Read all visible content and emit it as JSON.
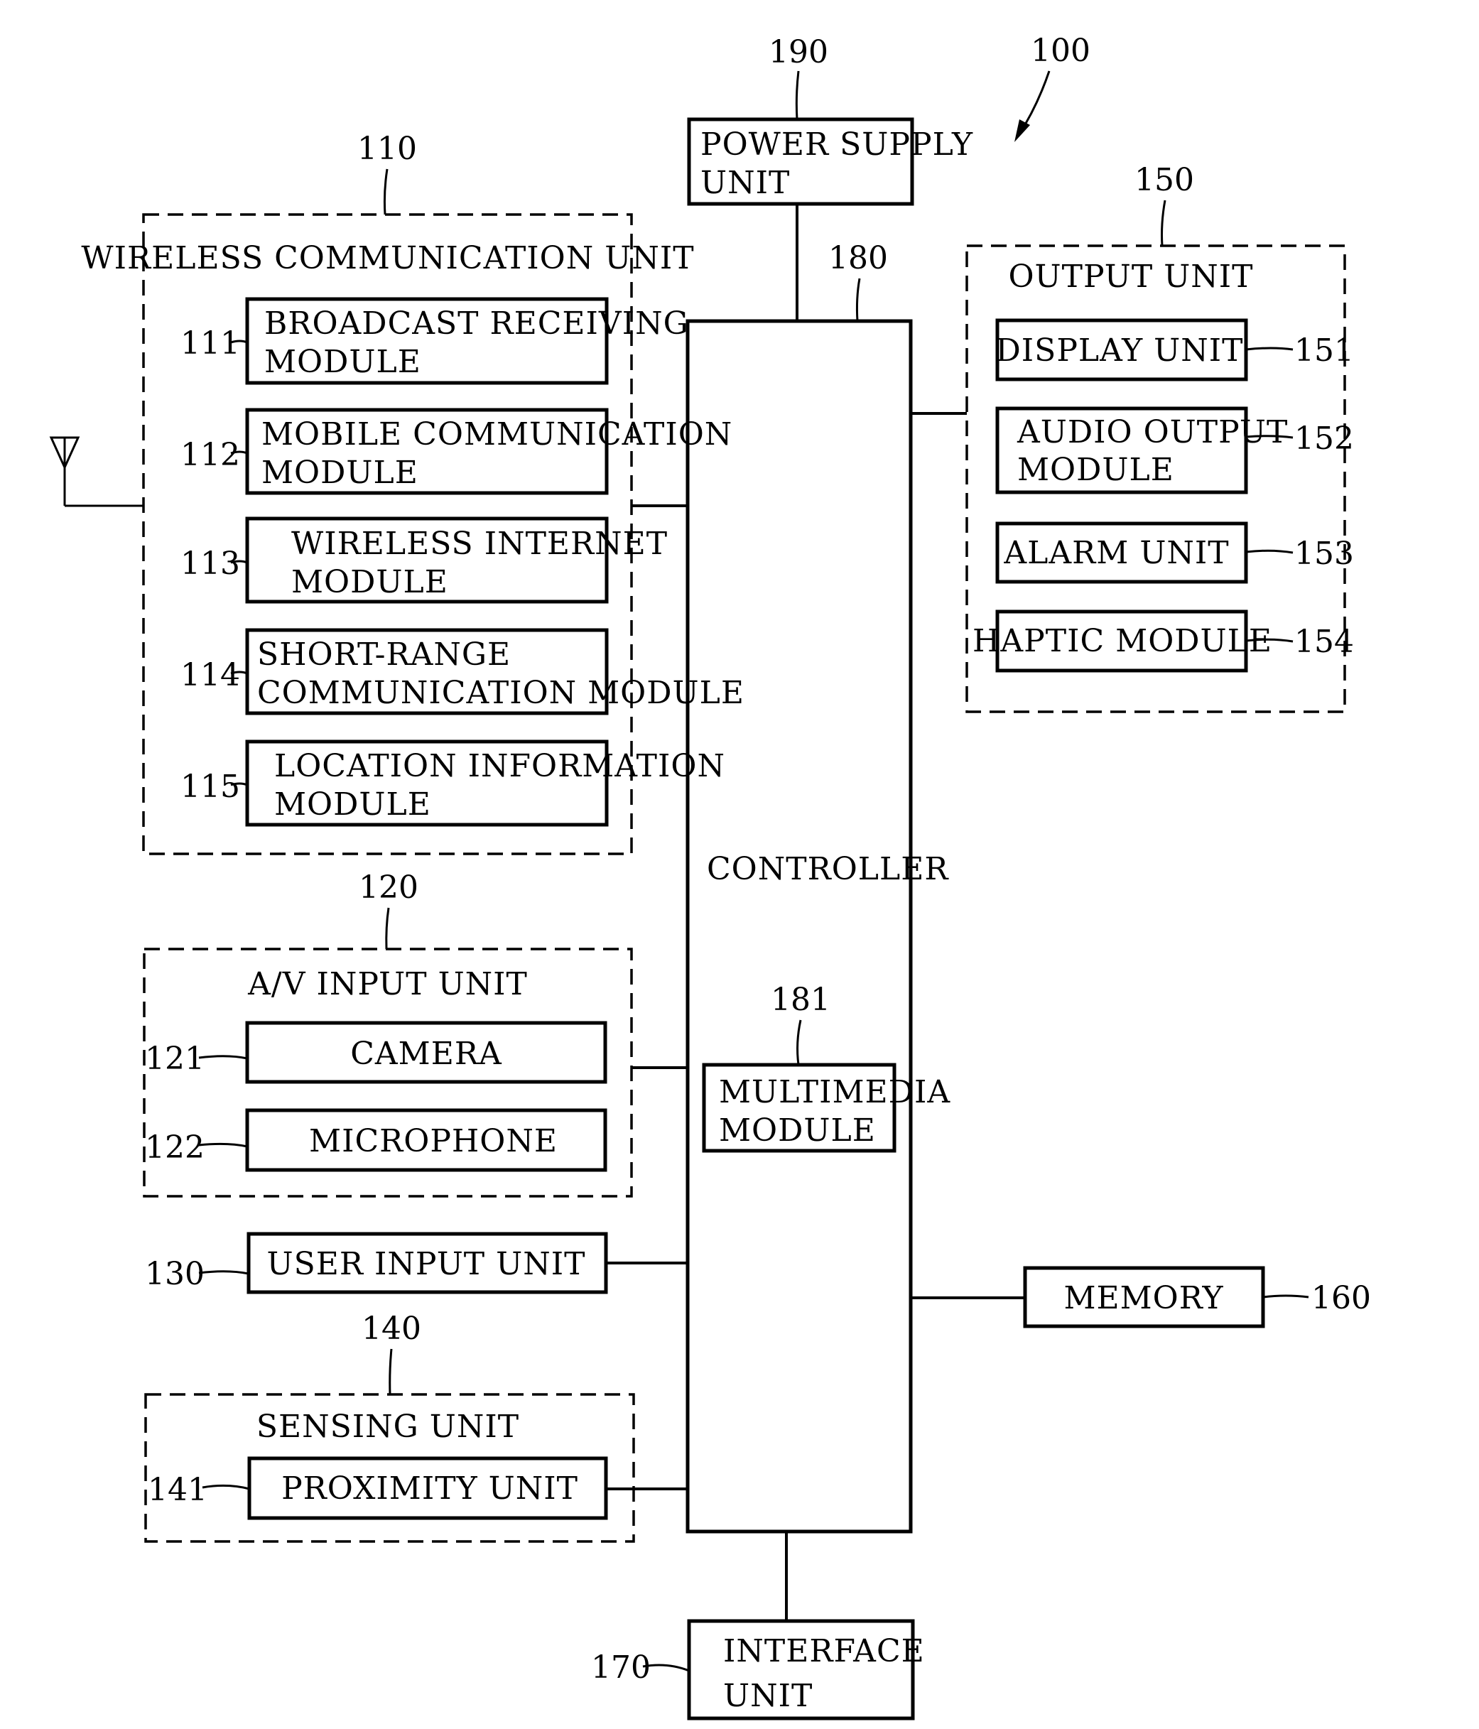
{
  "figure": {
    "ref": "100",
    "power_supply": {
      "ref": "190",
      "line1": "POWER SUPPLY",
      "line2": "UNIT"
    },
    "controller": {
      "ref": "180",
      "label": "CONTROLLER",
      "multimedia": {
        "ref": "181",
        "line1": "MULTIMEDIA",
        "line2": "MODULE"
      }
    },
    "wireless": {
      "ref": "110",
      "title": "WIRELESS COMMUNICATION UNIT",
      "modules": [
        {
          "ref": "111",
          "line1": "BROADCAST RECEIVING",
          "line2": "MODULE"
        },
        {
          "ref": "112",
          "line1": "MOBILE COMMUNICATION",
          "line2": "MODULE"
        },
        {
          "ref": "113",
          "line1": "WIRELESS INTERNET",
          "line2": "MODULE"
        },
        {
          "ref": "114",
          "line1": "SHORT-RANGE",
          "line2": "COMMUNICATION MODULE"
        },
        {
          "ref": "115",
          "line1": "LOCATION INFORMATION",
          "line2": "MODULE"
        }
      ]
    },
    "av_input": {
      "ref": "120",
      "title": "A/V INPUT UNIT",
      "modules": [
        {
          "ref": "121",
          "label": "CAMERA"
        },
        {
          "ref": "122",
          "label": "MICROPHONE"
        }
      ]
    },
    "user_input": {
      "ref": "130",
      "label": "USER INPUT UNIT"
    },
    "sensing": {
      "ref": "140",
      "title": "SENSING UNIT",
      "modules": [
        {
          "ref": "141",
          "label": "PROXIMITY UNIT"
        }
      ]
    },
    "output": {
      "ref": "150",
      "title": "OUTPUT UNIT",
      "modules": [
        {
          "ref": "151",
          "line1": "DISPLAY UNIT",
          "line2": ""
        },
        {
          "ref": "152",
          "line1": "AUDIO OUTPUT",
          "line2": "MODULE"
        },
        {
          "ref": "153",
          "line1": "ALARM UNIT",
          "line2": ""
        },
        {
          "ref": "154",
          "line1": "HAPTIC MODULE",
          "line2": ""
        }
      ]
    },
    "memory": {
      "ref": "160",
      "label": "MEMORY"
    },
    "interface": {
      "ref": "170",
      "line1": "INTERFACE",
      "line2": "UNIT"
    }
  }
}
